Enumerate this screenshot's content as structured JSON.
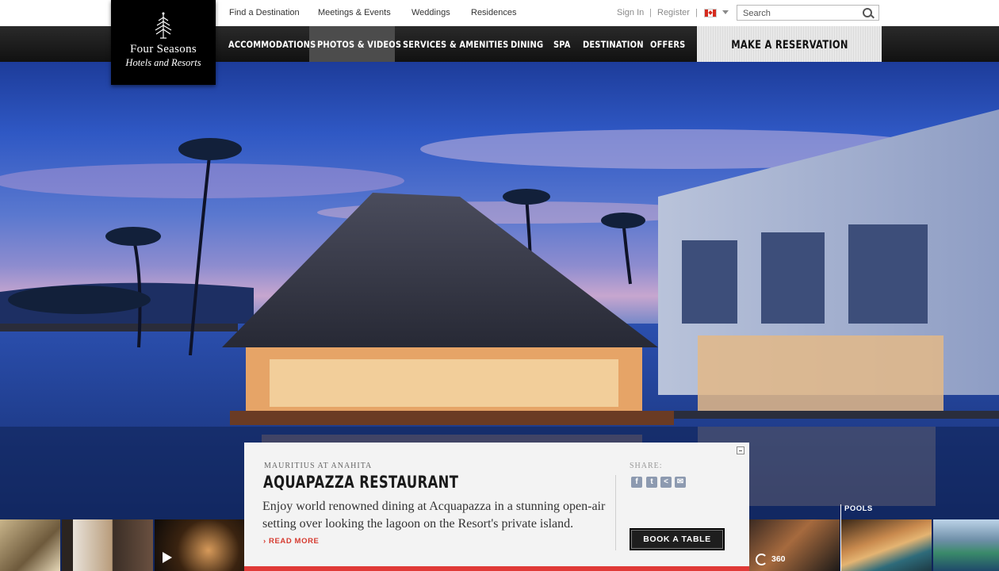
{
  "utility_nav": {
    "links": [
      "Find a Destination",
      "Meetings & Events",
      "Weddings",
      "Residences"
    ],
    "sign_in": "Sign In",
    "register": "Register",
    "separator": "|",
    "country_flag": "canada-flag-icon",
    "search_placeholder": "Search"
  },
  "logo": {
    "brand": "Four Seasons",
    "tagline": "Hotels and Resorts"
  },
  "main_nav": {
    "items": [
      "ACCOMMODATIONS",
      "PHOTOS & VIDEOS",
      "SERVICES & AMENITIES",
      "DINING",
      "SPA",
      "DESTINATION",
      "OFFERS"
    ],
    "active": "PHOTOS & VIDEOS",
    "reservation": "MAKE A RESERVATION"
  },
  "caption": {
    "eyebrow": "MAURITIUS AT ANAHITA",
    "title": "AQUAPAZZA RESTAURANT",
    "description": "Enjoy world renowned dining at Acquapazza in a stunning open-air setting over looking the lagoon on the Resort's private island.",
    "read_more": "› READ MORE",
    "share_label": "SHARE:",
    "share_icons": [
      "facebook-icon",
      "twitter-icon",
      "share-icon",
      "email-icon"
    ],
    "cta": "BOOK A TABLE"
  },
  "thumbnails": {
    "section_label": "POOLS",
    "pano_label": "360"
  },
  "colors": {
    "accent_red": "#e03a37",
    "nav_bg": "#111111",
    "nav_active": "#4c4c4c"
  }
}
